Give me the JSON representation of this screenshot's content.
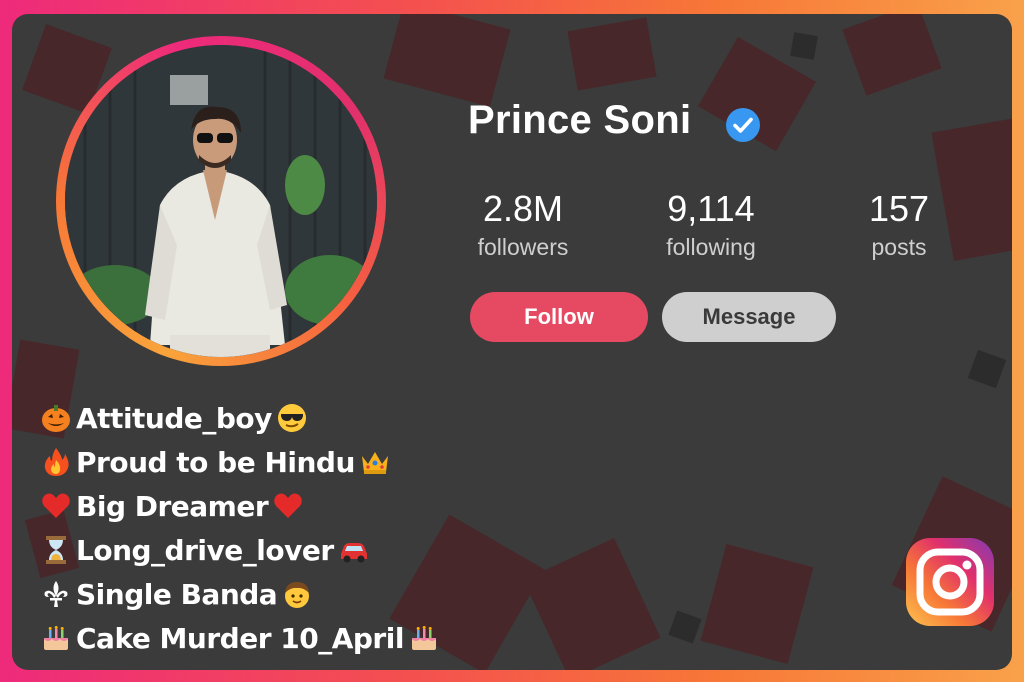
{
  "profile": {
    "name": "Prince Soni",
    "verified": true,
    "stats": {
      "followers": {
        "value": "2.8M",
        "label": "followers"
      },
      "following": {
        "value": "9,114",
        "label": "following"
      },
      "posts": {
        "value": "157",
        "label": "posts"
      }
    },
    "actions": {
      "follow_label": "Follow",
      "message_label": "Message"
    }
  },
  "bio": [
    {
      "text": "Attitude_boy",
      "icons": [
        "jack-o-lantern-icon",
        "sunglasses-face-icon"
      ]
    },
    {
      "text": "Proud to be Hindu",
      "icons": [
        "fire-icon",
        "crown-icon"
      ]
    },
    {
      "text": "Big Dreamer",
      "icons": [
        "red-heart-icon",
        "red-heart-icon"
      ]
    },
    {
      "text": "Long_drive_lover",
      "icons": [
        "hourglass-icon",
        "car-icon"
      ]
    },
    {
      "text": "Single Banda",
      "icons": [
        "fleur-de-lis-icon",
        "boy-face-icon"
      ]
    },
    {
      "text": "Cake Murder 10_April",
      "icons": [
        "birthday-cake-icon",
        "birthday-cake-icon"
      ]
    }
  ],
  "colors": {
    "follow_button": "#e64a63",
    "message_button": "#cfcfcf",
    "card_background": "#3b3b3b",
    "verified_badge": "#3897f0"
  },
  "brand_icon": "instagram-logo-icon"
}
